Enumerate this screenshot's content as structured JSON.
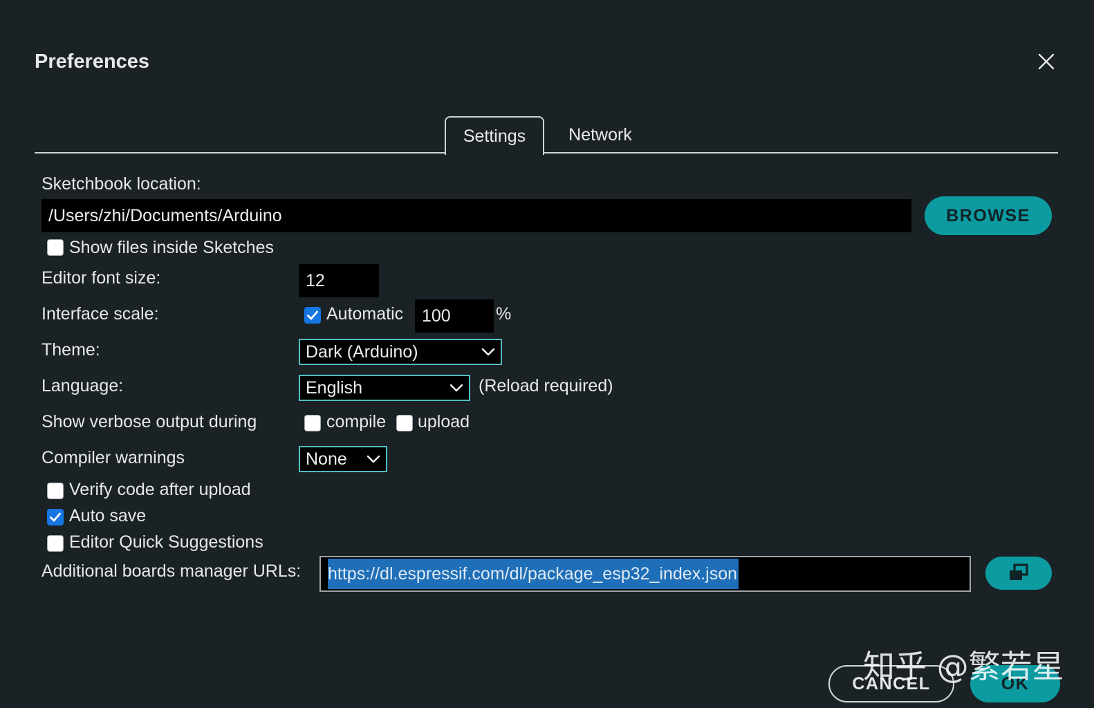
{
  "title": "Preferences",
  "tabs": [
    {
      "label": "Settings",
      "active": true
    },
    {
      "label": "Network",
      "active": false
    }
  ],
  "sketchbook": {
    "label": "Sketchbook location:",
    "value": "/Users/zhi/Documents/Arduino",
    "browse_label": "BROWSE",
    "show_files_label": "Show files inside Sketches",
    "show_files_checked": false
  },
  "editor_font": {
    "label": "Editor font size:",
    "value": "12"
  },
  "interface_scale": {
    "label": "Interface scale:",
    "automatic_label": "Automatic",
    "automatic_checked": true,
    "value": "100",
    "unit": "%"
  },
  "theme": {
    "label": "Theme:",
    "value": "Dark (Arduino)"
  },
  "language": {
    "label": "Language:",
    "value": "English",
    "note": "(Reload required)"
  },
  "verbose": {
    "label": "Show verbose output during",
    "compile_label": "compile",
    "compile_checked": false,
    "upload_label": "upload",
    "upload_checked": false
  },
  "compiler_warnings": {
    "label": "Compiler warnings",
    "value": "None"
  },
  "options": [
    {
      "label": "Verify code after upload",
      "checked": false
    },
    {
      "label": "Auto save",
      "checked": true
    },
    {
      "label": "Editor Quick Suggestions",
      "checked": false
    }
  ],
  "boards_urls": {
    "label": "Additional boards manager URLs:",
    "value": "https://dl.espressif.com/dl/package_esp32_index.json"
  },
  "footer": {
    "cancel_label": "CANCEL",
    "ok_label": "OK"
  },
  "watermark": "知乎 @繁若星",
  "colors": {
    "background": "#1b2225",
    "accent": "#0d9ba2",
    "select_border": "#4fbfc3",
    "checkbox_checked": "#1676e3",
    "selection": "#1f6fb8"
  }
}
